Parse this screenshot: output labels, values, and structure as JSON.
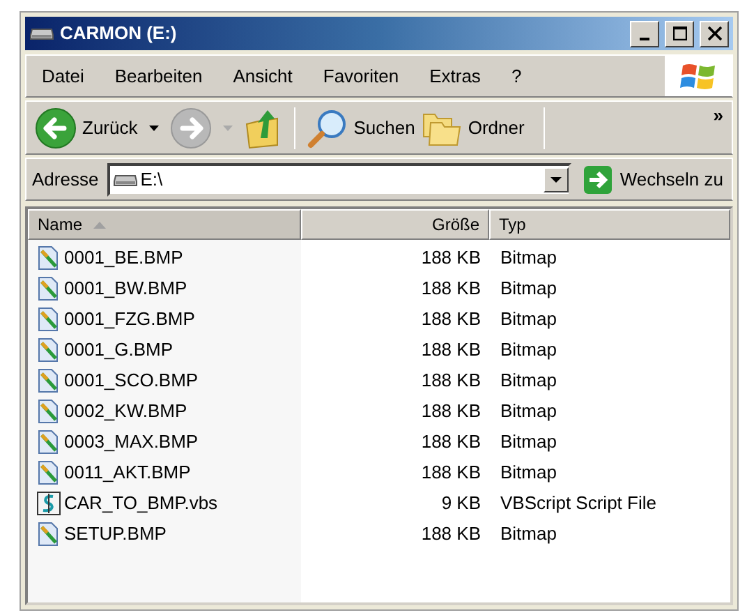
{
  "window": {
    "title": "CARMON (E:)"
  },
  "menu": [
    "Datei",
    "Bearbeiten",
    "Ansicht",
    "Favoriten",
    "Extras",
    "?"
  ],
  "toolbar": [
    {
      "kind": "back",
      "label": "Zurück",
      "disabled": false
    },
    {
      "kind": "forward",
      "disabled": true
    },
    {
      "kind": "up",
      "disabled": false
    },
    {
      "kind": "search",
      "label": "Suchen",
      "disabled": false
    },
    {
      "kind": "folders",
      "label": "Ordner",
      "disabled": false
    }
  ],
  "toolbar_more": "»",
  "address": {
    "label": "Adresse",
    "value": "E:\\",
    "go": "Wechseln zu"
  },
  "table": {
    "columns": [
      {
        "label": "Name",
        "sorted": true
      },
      {
        "label": "Größe",
        "sorted": false
      },
      {
        "label": "Typ",
        "sorted": false
      }
    ],
    "rows": [
      {
        "kind": "bitmap",
        "name": "0001_BE.BMP",
        "size": "188 KB",
        "type": "Bitmap"
      },
      {
        "kind": "bitmap",
        "name": "0001_BW.BMP",
        "size": "188 KB",
        "type": "Bitmap"
      },
      {
        "kind": "bitmap",
        "name": "0001_FZG.BMP",
        "size": "188 KB",
        "type": "Bitmap"
      },
      {
        "kind": "bitmap",
        "name": "0001_G.BMP",
        "size": "188 KB",
        "type": "Bitmap"
      },
      {
        "kind": "bitmap",
        "name": "0001_SCO.BMP",
        "size": "188 KB",
        "type": "Bitmap"
      },
      {
        "kind": "bitmap",
        "name": "0002_KW.BMP",
        "size": "188 KB",
        "type": "Bitmap"
      },
      {
        "kind": "bitmap",
        "name": "0003_MAX.BMP",
        "size": "188 KB",
        "type": "Bitmap"
      },
      {
        "kind": "bitmap",
        "name": "0011_AKT.BMP",
        "size": "188 KB",
        "type": "Bitmap"
      },
      {
        "kind": "script",
        "name": "CAR_TO_BMP.vbs",
        "size": "9 KB",
        "type": "VBScript Script File"
      },
      {
        "kind": "bitmap",
        "name": "SETUP.BMP",
        "size": "188 KB",
        "type": "Bitmap"
      }
    ]
  }
}
